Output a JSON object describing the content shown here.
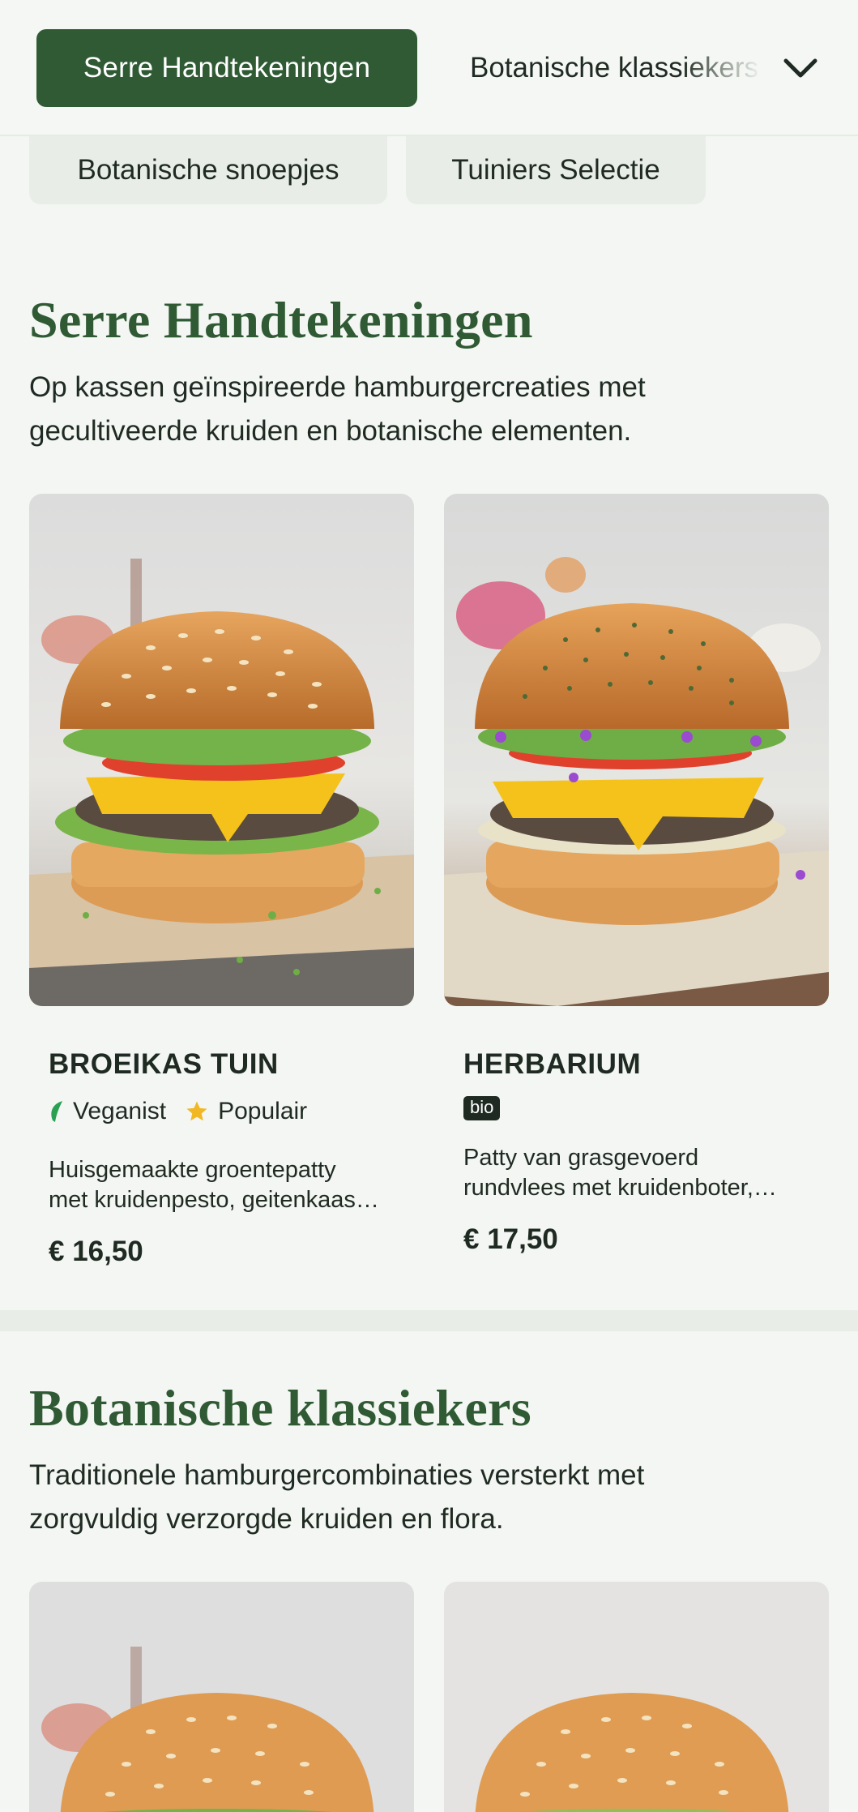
{
  "nav": {
    "active": "Serre Handtekeningen",
    "next": "Botanische klassiekers",
    "chips": [
      "Botanische snoepjes",
      "Tuiniers Selectie"
    ]
  },
  "sections": [
    {
      "title": "Serre Handtekeningen",
      "desc_lines": [
        "Op kassen geïnspireerde hamburgercreaties met",
        "gecultiveerde kruiden en botanische elementen."
      ],
      "items": [
        {
          "name": "BROEIKAS TUIN",
          "tags": [
            "Veganist",
            "Populair"
          ],
          "desc_lines": [
            "Huisgemaakte groentepatty",
            "met kruidenpesto, geitenkaas…"
          ],
          "price": "€ 16,50"
        },
        {
          "name": "HERBARIUM",
          "badge": "bio",
          "desc_lines": [
            "Patty van grasgevoerd",
            "rundvlees met kruidenboter,…"
          ],
          "price": "€ 17,50"
        }
      ]
    },
    {
      "title": "Botanische klassiekers",
      "desc_lines": [
        "Traditionele hamburgercombinaties versterkt met",
        "zorgvuldig verzorgde kruiden en flora."
      ]
    }
  ],
  "icons": {
    "chevron": "chevron-down-icon",
    "leaf": "leaf-icon",
    "star": "star-icon"
  },
  "colors": {
    "brand": "#2f5a34",
    "star": "#f2b824",
    "leaf": "#2aa152",
    "background": "#f3f6f2"
  }
}
